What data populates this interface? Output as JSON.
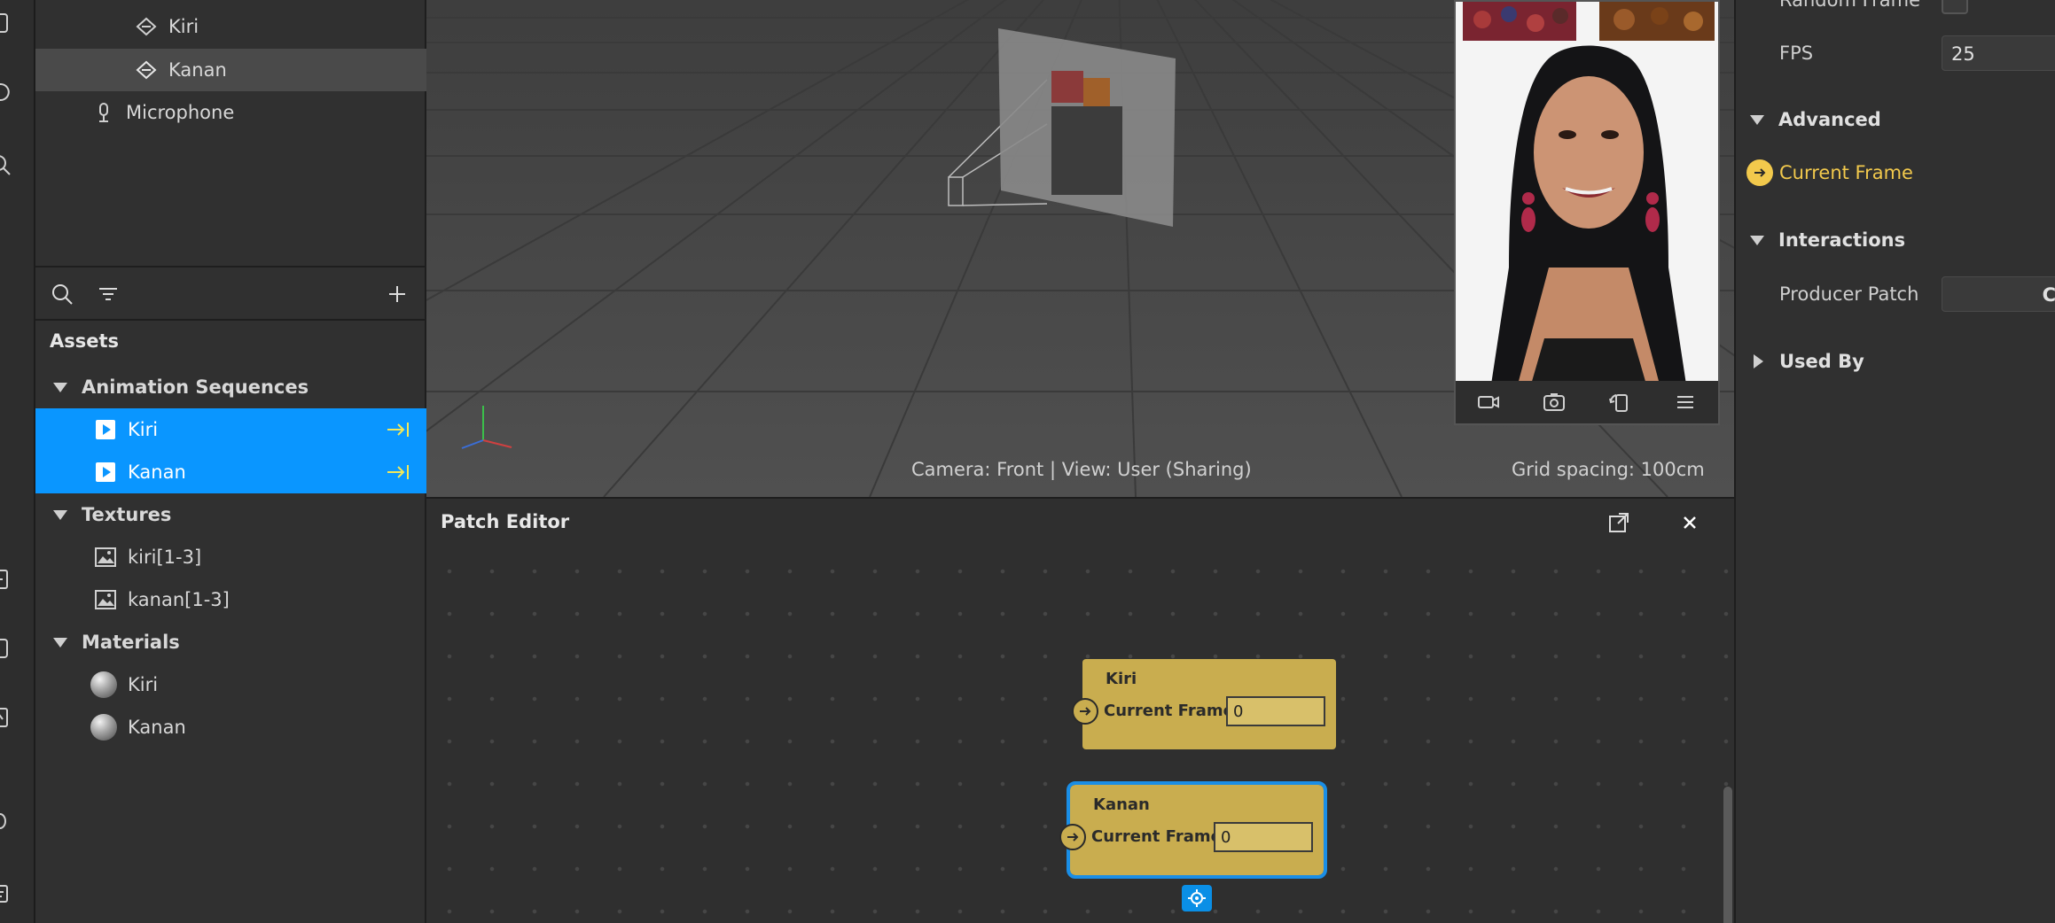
{
  "scene": {
    "items": [
      {
        "label": "Kiri"
      },
      {
        "label": "Kanan"
      },
      {
        "label": "Microphone"
      }
    ]
  },
  "assets": {
    "title": "Assets",
    "groups": [
      {
        "label": "Animation Sequences",
        "items": [
          {
            "label": "Kiri"
          },
          {
            "label": "Kanan"
          }
        ]
      },
      {
        "label": "Textures",
        "items": [
          {
            "label": "kiri[1-3]"
          },
          {
            "label": "kanan[1-3]"
          }
        ]
      },
      {
        "label": "Materials",
        "items": [
          {
            "label": "Kiri"
          },
          {
            "label": "Kanan"
          }
        ]
      }
    ]
  },
  "viewport": {
    "camera_caption": "Camera: Front | View: User (Sharing)",
    "grid_caption": "Grid spacing: 100cm"
  },
  "patch_editor": {
    "title": "Patch Editor",
    "nodes": [
      {
        "title": "Kiri",
        "port_label": "Current Frame",
        "value": "0"
      },
      {
        "title": "Kanan",
        "port_label": "Current Frame",
        "value": "0"
      }
    ]
  },
  "inspector": {
    "random_frame_label": "Random Frame",
    "fps_label": "FPS",
    "fps_value": "25",
    "advanced_label": "Advanced",
    "current_frame_label": "Current Frame",
    "interactions_label": "Interactions",
    "producer_patch_label": "Producer Patch",
    "producer_patch_value": "C",
    "used_by_label": "Used By"
  },
  "colors": {
    "selection_blue": "#0a96ff",
    "patch_yellow": "#c9ad4f",
    "current_frame_text": "#f2c94c"
  }
}
